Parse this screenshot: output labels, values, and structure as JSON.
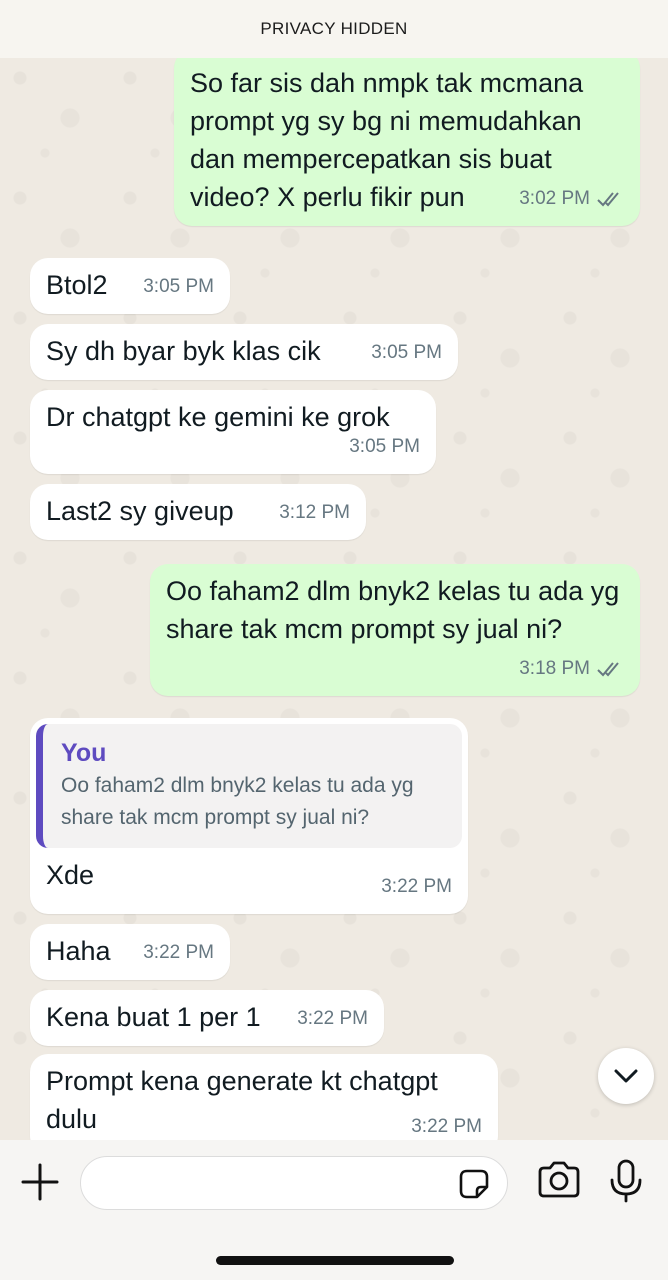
{
  "banner": {
    "text": "PRIVACY HIDDEN"
  },
  "messages": [
    {
      "text": "So far sis dah nmpk tak mcmana prompt yg sy bg ni memudahkan dan mempercepatkan sis buat video? X perlu fikir pun",
      "time": "3:02 PM",
      "direction": "out",
      "read": true
    },
    {
      "text": "Btol2",
      "time": "3:05 PM",
      "direction": "in"
    },
    {
      "text": "Sy dh byar byk klas cik",
      "time": "3:05 PM",
      "direction": "in"
    },
    {
      "text": "Dr chatgpt ke gemini ke grok",
      "time": "3:05 PM",
      "direction": "in"
    },
    {
      "text": "Last2 sy giveup",
      "time": "3:12 PM",
      "direction": "in"
    },
    {
      "text": "Oo faham2 dlm bnyk2 kelas tu ada yg share tak mcm prompt sy jual ni?",
      "time": "3:18 PM",
      "direction": "out",
      "read": true
    },
    {
      "quote_author": "You",
      "quote_text": "Oo faham2 dlm bnyk2 kelas tu ada yg share tak mcm prompt sy jual ni?",
      "text": "Xde",
      "time": "3:22 PM",
      "direction": "in"
    },
    {
      "text": "Haha",
      "time": "3:22 PM",
      "direction": "in"
    },
    {
      "text": "Kena buat 1 per 1",
      "time": "3:22 PM",
      "direction": "in"
    },
    {
      "text": "Prompt kena generate kt chatgpt dulu",
      "time": "3:22 PM",
      "direction": "in"
    }
  ],
  "composer": {
    "placeholder": ""
  },
  "icons": {
    "plus": "plus-icon",
    "sticker": "sticker-icon",
    "camera": "camera-icon",
    "mic": "microphone-icon",
    "scroll_down": "chevron-down-icon",
    "read_receipt": "double-check-icon"
  },
  "colors": {
    "outgoing_bubble": "#d9fdd3",
    "incoming_bubble": "#ffffff",
    "quote_accent": "#5e4bc0",
    "background": "#efeae2"
  }
}
